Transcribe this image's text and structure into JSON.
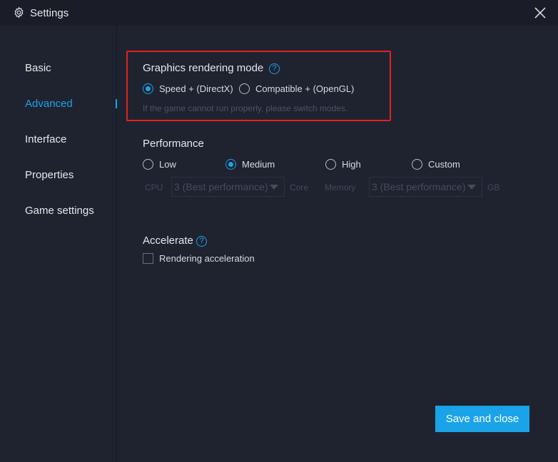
{
  "window": {
    "title": "Settings",
    "icon": "gear-icon",
    "close_icon": "close-icon"
  },
  "sidebar": {
    "items": [
      {
        "label": "Basic",
        "active": false
      },
      {
        "label": "Advanced",
        "active": true
      },
      {
        "label": "Interface",
        "active": false
      },
      {
        "label": "Properties",
        "active": false
      },
      {
        "label": "Game settings",
        "active": false
      }
    ]
  },
  "graphics": {
    "title": "Graphics rendering mode",
    "help": "?",
    "options": [
      {
        "label": "Speed + (DirectX)",
        "checked": true
      },
      {
        "label": "Compatible + (OpenGL)",
        "checked": false
      }
    ],
    "hint": "If the game cannot run properly, please switch modes."
  },
  "performance": {
    "title": "Performance",
    "options": [
      {
        "label": "Low",
        "checked": false
      },
      {
        "label": "Medium",
        "checked": true
      },
      {
        "label": "High",
        "checked": false
      },
      {
        "label": "Custom",
        "checked": false
      }
    ],
    "cpu_label": "CPU",
    "cpu_value": "3 (Best performance)",
    "core_label": "Core",
    "memory_label": "Memory",
    "memory_value": "3 (Best performance)",
    "gb_label": "GB"
  },
  "accelerate": {
    "title": "Accelerate",
    "help": "?",
    "checkbox_label": "Rendering acceleration",
    "checked": false
  },
  "footer": {
    "save_label": "Save and close"
  },
  "colors": {
    "accent": "#1aa3e8",
    "background": "#1f2330",
    "titlebar": "#1a1d27",
    "highlight": "#e3211f"
  }
}
